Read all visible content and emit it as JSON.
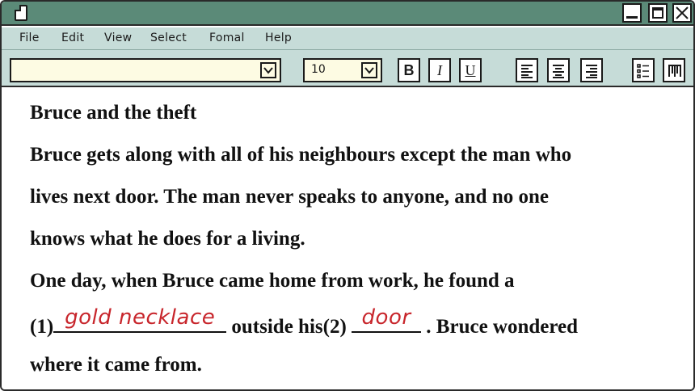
{
  "titlebar": {
    "icons": {
      "app": "document-icon",
      "minimize": "minimize-icon",
      "maximize": "maximize-icon",
      "close": "close-icon"
    }
  },
  "menu": {
    "items": [
      "File",
      "Edit",
      "View",
      "Select",
      "Fomal",
      "Help"
    ]
  },
  "toolbar": {
    "font_value": "",
    "size_value": "10",
    "bold_label": "B",
    "italic_label": "I",
    "underline_label": "U",
    "icons": [
      "chevron-down-icon",
      "align-left-icon",
      "align-center-icon",
      "align-right-icon",
      "bulleted-list-icon",
      "columns-icon"
    ]
  },
  "document": {
    "title": "Bruce and the theft",
    "lines": [
      "Bruce gets along with all of his neighbours except the man who",
      "lives next door. The man never speaks to anyone, and no one",
      "knows what he does for a living.",
      "One day, when Bruce came home from work, he found a"
    ],
    "blank_line": {
      "label1": "(1)",
      "answer1": "gold necklace",
      "middle": " outside his(2) ",
      "answer2": "door",
      "end": " . Bruce wondered"
    },
    "last_line": "where it came from."
  },
  "colors": {
    "titlebar": "#5b8a78",
    "toolbar": "#c6dcd8",
    "input_bg": "#fdfbe3",
    "answer": "#c8262c"
  }
}
